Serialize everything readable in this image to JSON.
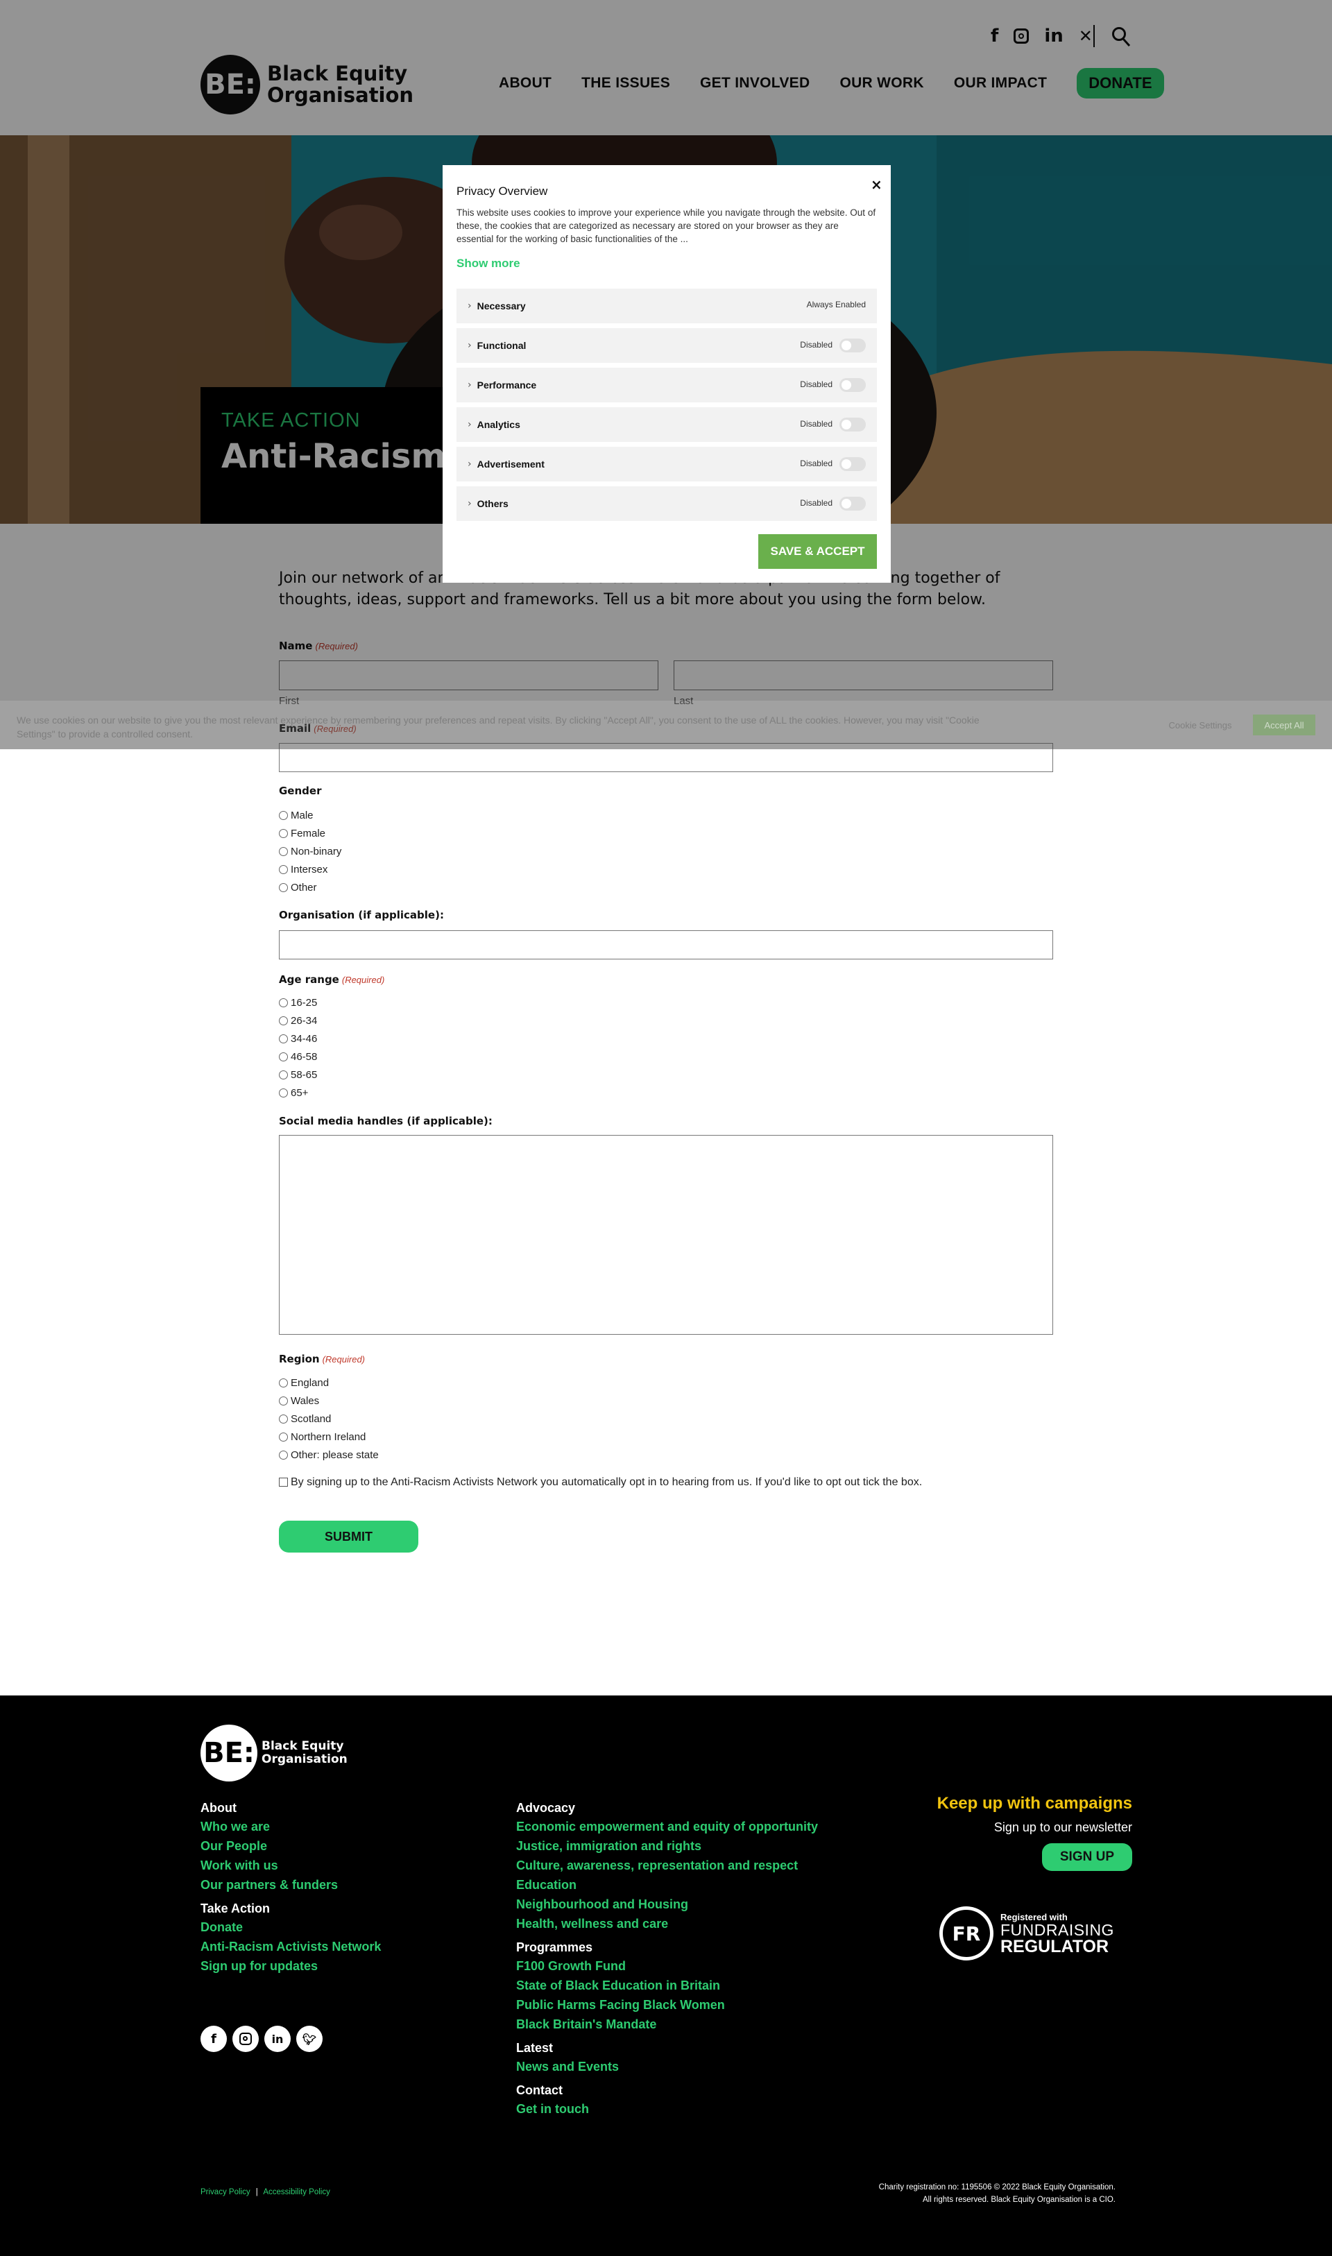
{
  "header": {
    "logo": {
      "mark": "BE:",
      "line1": "Black Equity",
      "line2": "Organisation"
    },
    "social_icons": [
      "facebook-icon",
      "instagram-icon",
      "linkedin-icon",
      "x-icon"
    ],
    "nav": [
      "ABOUT",
      "THE ISSUES",
      "GET INVOLVED",
      "OUR WORK",
      "OUR IMPACT"
    ],
    "donate": "DONATE"
  },
  "hero": {
    "eyebrow": "TAKE ACTION",
    "title": "Anti-Racism Activists Network"
  },
  "form": {
    "intro": "Join our network of anti-racism activists across the UK and be a part of the coming together of thoughts, ideas, support and frameworks. Tell us a bit more about you using the form below.",
    "name_label": "Name",
    "required": "(Required)",
    "first": "First",
    "last": "Last",
    "email_label": "Email",
    "gender_label": "Gender",
    "gender_options": [
      "Male",
      "Female",
      "Non-binary",
      "Intersex",
      "Other"
    ],
    "org_label": "Organisation (if applicable):",
    "age_label": "Age range",
    "age_options": [
      "16-25",
      "26-34",
      "34-46",
      "46-58",
      "58-65",
      "65+"
    ],
    "social_label": "Social media handles (if applicable):",
    "region_label": "Region",
    "region_options": [
      "England",
      "Wales",
      "Scotland",
      "Northern Ireland",
      "Other: please state"
    ],
    "optout": "By signing up to the Anti-Racism Activists Network you automatically opt in to hearing from us. If you'd like to opt out tick the box.",
    "submit": "SUBMIT"
  },
  "cookie_bar": {
    "text": "We use cookies on our website to give you the most relevant experience by remembering your preferences and repeat visits. By clicking \"Accept All\", you consent to the use of ALL the cookies. However, you may visit \"Cookie Settings\" to provide a controlled consent.",
    "settings": "Cookie Settings",
    "accept": "Accept All"
  },
  "modal": {
    "title": "Privacy Overview",
    "close": "×",
    "description": "This website uses cookies to improve your experience while you navigate through the website. Out of these, the cookies that are categorized as necessary are stored on your browser as they are essential for the working of basic functionalities of the ...",
    "show_more": "Show more",
    "categories": [
      {
        "name": "Necessary",
        "state": "Always Enabled"
      },
      {
        "name": "Functional",
        "state": "Disabled"
      },
      {
        "name": "Performance",
        "state": "Disabled"
      },
      {
        "name": "Analytics",
        "state": "Disabled"
      },
      {
        "name": "Advertisement",
        "state": "Disabled"
      },
      {
        "name": "Others",
        "state": "Disabled"
      }
    ],
    "save": "SAVE & ACCEPT"
  },
  "footer": {
    "logo": {
      "mark": "BE:",
      "line1": "Black Equity",
      "line2": "Organisation"
    },
    "about_head": "About",
    "about_links": [
      "Who we are",
      "Our People",
      "Work with us",
      "Our partners & funders"
    ],
    "take_action_head": "Take Action",
    "take_action_links": [
      "Donate",
      "Anti-Racism Activists Network",
      "Sign up for updates"
    ],
    "advocacy_head": "Advocacy",
    "advocacy_links": [
      "Economic empowerment and equity of opportunity",
      "Justice, immigration and rights",
      "Culture, awareness, representation and respect",
      "Education",
      "Neighbourhood and Housing",
      "Health, wellness and care"
    ],
    "programmes_head": "Programmes",
    "programmes_links": [
      "F100 Growth Fund",
      "State of Black Education in Britain",
      "Public Harms Facing Black Women",
      "Black Britain's Mandate"
    ],
    "latest_head": "Latest",
    "latest_links": [
      "News and Events"
    ],
    "contact_head": "Contact",
    "contact_links": [
      "Get in touch"
    ],
    "campaigns_title": "Keep up with campaigns",
    "newsletter_text": "Sign up to our newsletter",
    "signup": "SIGN UP",
    "regulator": {
      "mark": "FR",
      "registered": "Registered with",
      "line1": "FUNDRAISING",
      "line2": "REGULATOR"
    },
    "privacy": "Privacy Policy",
    "sep": "|",
    "accessibility": "Accessibility Policy",
    "charity_line1": "Charity registration no: 1195506 © 2022 Black Equity Organisation.",
    "charity_line2": "All rights reserved. Black Equity Organisation is a CIO.",
    "social_icons": [
      "facebook-icon",
      "instagram-icon",
      "linkedin-icon",
      "twitter-icon"
    ]
  },
  "colors": {
    "accent": "#2ecc71",
    "footer_bg": "#000000",
    "campaign_title": "#f1c40f",
    "required": "#c0392b",
    "save_button": "#6ab04c"
  }
}
